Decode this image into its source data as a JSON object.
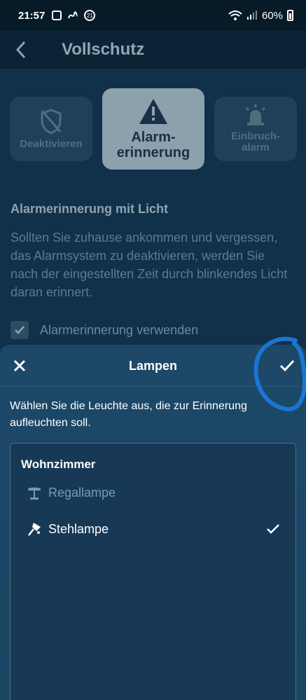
{
  "status_bar": {
    "time": "21:57",
    "notification_icons": [
      "screenshot-icon",
      "signature-icon",
      "badge-21-icon"
    ],
    "badge_text": "21",
    "battery": "60%"
  },
  "app_bar": {
    "title": "Vollschutz"
  },
  "modes": {
    "deactivate": "Deaktivieren",
    "alarm_reminder_line1": "Alarm-",
    "alarm_reminder_line2": "erinnerung",
    "burglary_line1": "Einbruch-",
    "burglary_line2": "alarm"
  },
  "section": {
    "title": "Alarmerinnerung mit Licht",
    "description": "Sollten Sie zuhause ankommen und vergessen, das Alarmsystem zu deaktivieren, werden Sie nach der eingestellten Zeit durch blinkendes Licht daran erinnert.",
    "checkbox_label": "Alarmerinnerung verwenden"
  },
  "sheet": {
    "title": "Lampen",
    "description": "Wählen Sie die Leuchte aus, die zur Erinnerung aufleuchten soll.",
    "group": "Wohnzimmer",
    "lamps": [
      {
        "name": "Regallampe",
        "selected": false
      },
      {
        "name": "Stehlampe",
        "selected": true
      }
    ]
  },
  "colors": {
    "sheet_bg": "#1d4868",
    "accent_blue": "#1976d2"
  }
}
